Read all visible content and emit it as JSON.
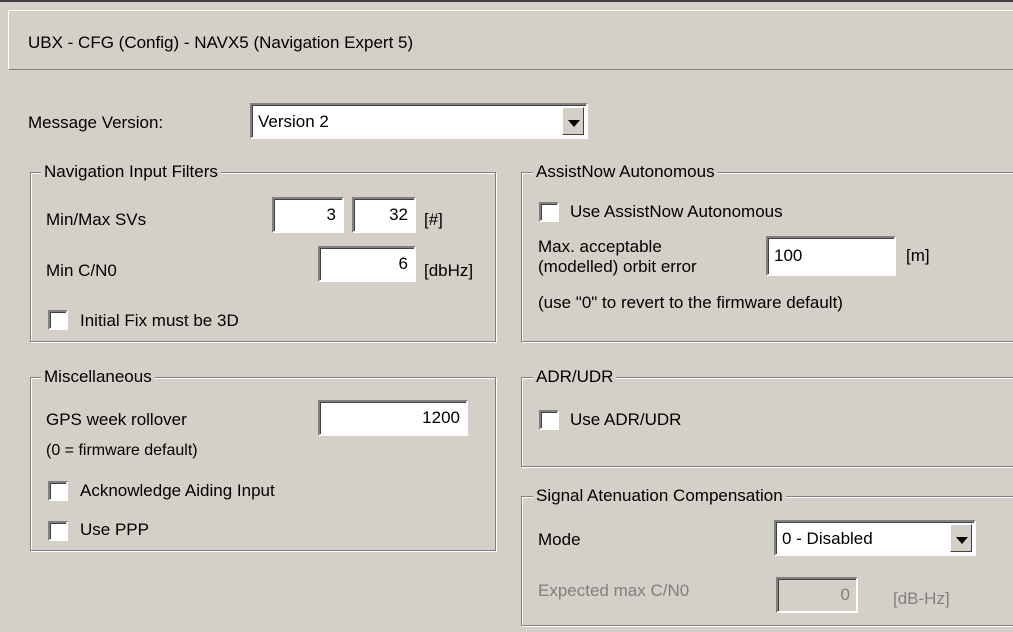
{
  "title": "UBX - CFG (Config) - NAVX5 (Navigation Expert 5)",
  "message_version": {
    "label": "Message Version:",
    "value": "Version 2"
  },
  "nav_input_filters": {
    "title": "Navigation Input Filters",
    "min_max_svs": {
      "label": "Min/Max SVs",
      "min": "3",
      "max": "32",
      "unit": "[#]"
    },
    "min_cn0": {
      "label": "Min C/N0",
      "value": "6",
      "unit": "[dbHz]"
    },
    "initial_fix_3d": {
      "label": "Initial Fix must be 3D",
      "checked": false
    }
  },
  "assistnow": {
    "title": "AssistNow Autonomous",
    "use_label": "Use AssistNow Autonomous",
    "use_checked": false,
    "orbit_error_label_line1": "Max. acceptable",
    "orbit_error_label_line2": "(modelled) orbit error",
    "orbit_error_value": "100",
    "orbit_error_unit": "[m]",
    "hint": "(use \"0\" to revert to the firmware default)"
  },
  "misc": {
    "title": "Miscellaneous",
    "gps_week_label": "GPS week rollover",
    "gps_week_value": "1200",
    "gps_week_hint": "(0 = firmware default)",
    "ack_aiding_label": "Acknowledge Aiding Input",
    "ack_aiding_checked": false,
    "use_ppp_label": "Use PPP",
    "use_ppp_checked": false
  },
  "adr_udr": {
    "title": "ADR/UDR",
    "use_label": "Use ADR/UDR",
    "use_checked": false
  },
  "signal_comp": {
    "title": "Signal Atenuation Compensation",
    "mode_label": "Mode",
    "mode_value": "0 - Disabled",
    "expected_label": "Expected max C/N0",
    "expected_value": "0",
    "expected_unit": "[dB-Hz]"
  },
  "colors": {
    "background": "#d4d0c8",
    "field": "#ffffff",
    "disabled_text": "#808080"
  }
}
